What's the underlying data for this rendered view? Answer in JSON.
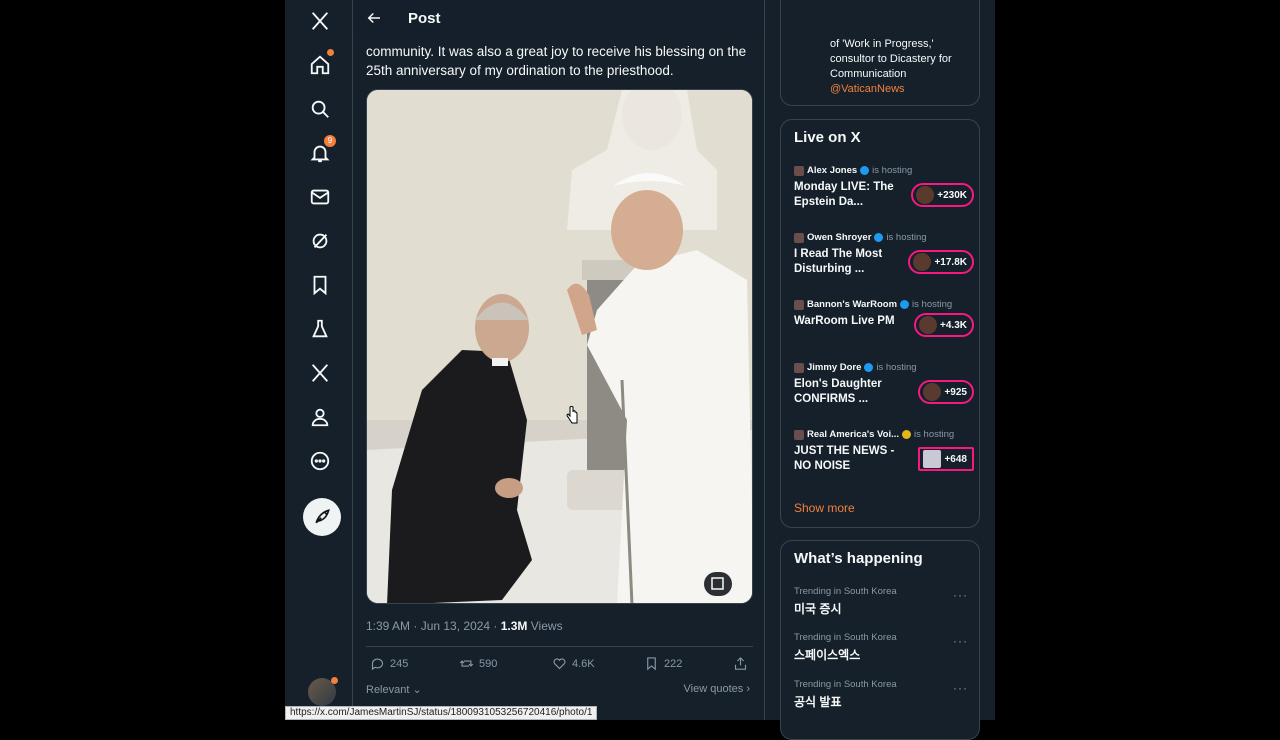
{
  "nav": {
    "items": [
      {
        "name": "x-logo-icon"
      },
      {
        "name": "home-icon"
      },
      {
        "name": "explore-icon"
      },
      {
        "name": "notifications-icon",
        "badge": "9"
      },
      {
        "name": "messages-icon"
      },
      {
        "name": "grok-icon"
      },
      {
        "name": "bookmarks-icon"
      },
      {
        "name": "communities-icon"
      },
      {
        "name": "premium-icon"
      },
      {
        "name": "profile-icon"
      },
      {
        "name": "more-icon"
      }
    ],
    "compose_icon": "feather-icon"
  },
  "header": {
    "title": "Post"
  },
  "post": {
    "text": "community. It was also a great joy to receive his blessing on the 25th anniversary of my ordination to the priesthood.",
    "timestamp": "1:39 AM · Jun 13, 2024 · ",
    "views": "1.3M",
    "views_label": " Views",
    "replies": "245",
    "reposts": "590",
    "likes": "4.6K",
    "bookmarks": "222",
    "sort_label": "Relevant",
    "view_quotes": "View quotes"
  },
  "search": {
    "placeholder": "Search"
  },
  "bio": {
    "text": "of 'Work in Progress,' consultor to Dicastery for Communication",
    "handle": "@VaticanNews"
  },
  "live": {
    "title": "Live on X",
    "hosting_label": "is hosting",
    "items": [
      {
        "host": "Alex Jones",
        "title": "Monday LIVE: The Epstein Da...",
        "count": "+230K"
      },
      {
        "host": "Owen Shroyer",
        "title": "I Read The Most Disturbing ...",
        "count": "+17.8K"
      },
      {
        "host": "Bannon's WarRoom",
        "title": "WarRoom Live PM",
        "count": "+4.3K"
      },
      {
        "host": "Jimmy Dore",
        "title": "Elon's Daughter CONFIRMS ...",
        "count": "+925"
      },
      {
        "host": "Real America's Voi...",
        "title": "JUST THE NEWS - NO NOISE",
        "count": "+648"
      }
    ],
    "show_more": "Show more"
  },
  "happening": {
    "title": "What’s happening",
    "trends": [
      {
        "category": "Trending in South Korea",
        "topic": "미국 증시"
      },
      {
        "category": "Trending in South Korea",
        "topic": "스페이스엑스"
      },
      {
        "category": "Trending in South Korea",
        "topic": "공식 발표"
      }
    ]
  },
  "statusbar": {
    "url": "https://x.com/JamesMartinSJ/status/1800931053256720416/photo/1"
  },
  "colors": {
    "background": "#15202b",
    "accent": "#f0803c",
    "live_ring": "#f91880",
    "verified": "#1d9bf0"
  }
}
